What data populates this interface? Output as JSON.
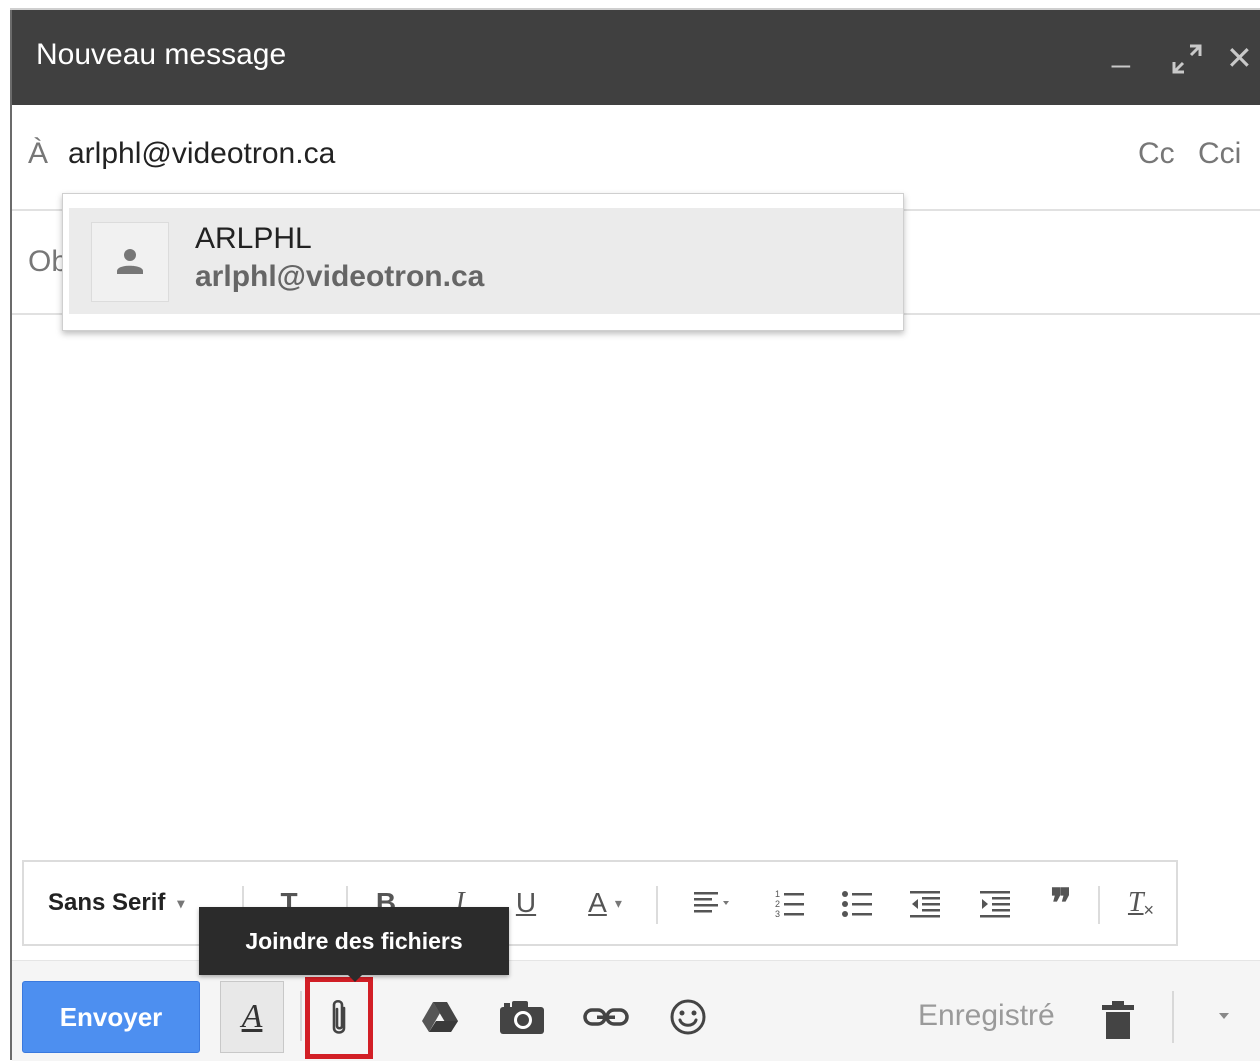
{
  "window": {
    "title": "Nouveau message",
    "minimize_glyph": "_",
    "expand_glyph": "⤢",
    "close_glyph": "✕"
  },
  "recipient": {
    "label": "À",
    "value": "arlphl@videotron.ca",
    "cc_label": "Cc",
    "cci_label": "Cci"
  },
  "subject": {
    "placeholder": "Objet"
  },
  "suggestion": {
    "name": "ARLPHL",
    "email": "arlphl@videotron.ca",
    "icon": "person-icon"
  },
  "format_bar": {
    "font": "Sans Serif",
    "size_glyph": "T",
    "bold_glyph": "B",
    "italic_glyph": "I",
    "underline_glyph": "U",
    "color_glyph": "A",
    "quote_glyph": "❞",
    "clear_glyph": "T"
  },
  "toolbar": {
    "send_label": "Envoyer",
    "format_toggle_glyph": "A",
    "saved_status": "Enregistré",
    "attach_tooltip": "Joindre des fichiers"
  },
  "colors": {
    "titlebar": "#404040",
    "send_button": "#4d8ff0",
    "highlight_box": "#d21f26"
  }
}
